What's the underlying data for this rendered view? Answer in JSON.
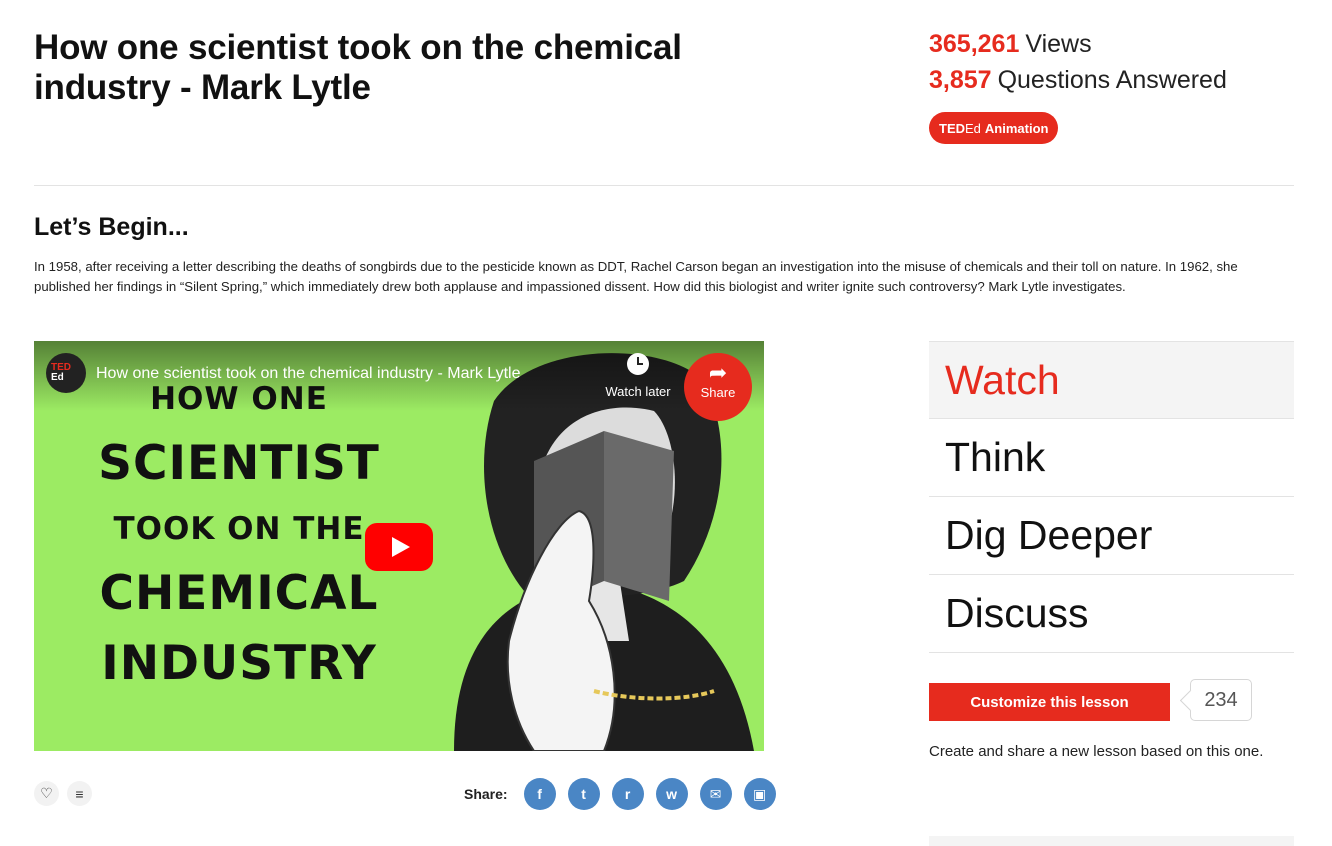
{
  "lesson": {
    "title": "How one scientist took on the chemical industry - Mark Lytle"
  },
  "stats": {
    "views_number": "365,261",
    "views_label": "Views",
    "answered_number": "3,857",
    "answered_label": "Questions Answered"
  },
  "badge": {
    "ted": "TED",
    "ed": "Ed",
    "label": "Animation"
  },
  "section": {
    "heading": "Let’s Begin...",
    "description": "In 1958, after receiving a letter describing the deaths of songbirds due to the pesticide known as DDT, Rachel Carson began an investigation into the misuse of chemicals and their toll on nature. In 1962, she published her findings in “Silent Spring,” which immediately drew both applause and impassioned dissent. How did this biologist and writer ignite such controversy? Mark Lytle investigates."
  },
  "video": {
    "title": "How one scientist took on the chemical industry - Mark Lytle",
    "channel_ted": "TED",
    "channel_ed": "Ed",
    "watch_later": "Watch later",
    "share": "Share",
    "thumb_lines": [
      "HOW ONE",
      "SCIENTIST",
      "TOOK ON THE",
      "CHEMICAL",
      "INDUSTRY"
    ]
  },
  "share_row": {
    "label": "Share:",
    "icons": [
      "facebook-icon",
      "twitter-icon",
      "reddit-icon",
      "whatsapp-icon",
      "email-icon",
      "embed-icon"
    ]
  },
  "tabs": [
    "Watch",
    "Think",
    "Dig Deeper",
    "Discuss"
  ],
  "customize": {
    "button_label": "Customize this lesson",
    "count": "234",
    "description": "Create and share a new lesson based on this one."
  },
  "colors": {
    "accent": "#e62b1e",
    "share_icon_bg": "#4a86c5",
    "thumbnail_bg": "#9ceb63"
  }
}
